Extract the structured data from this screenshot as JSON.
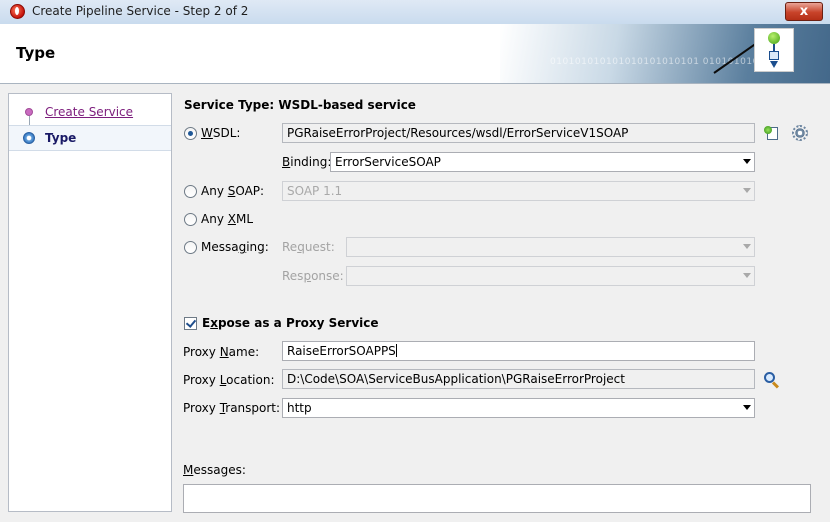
{
  "window": {
    "title": "Create Pipeline Service - Step 2 of 2",
    "close_label": "x"
  },
  "banner": {
    "title": "Type",
    "binary_text": "010101010101010101010101 0101010101010"
  },
  "nav": {
    "items": [
      {
        "label": "Create Service",
        "state": "visited"
      },
      {
        "label": "Type",
        "state": "current"
      }
    ]
  },
  "service_type": {
    "heading": "Service Type: WSDL-based service",
    "wsdl": {
      "label_prefix": "",
      "label_mnemonic": "W",
      "label_rest": "SDL:",
      "value": "PGRaiseErrorProject/Resources/wsdl/ErrorServiceV1SOAP",
      "selected": true
    },
    "binding": {
      "label_prefix": "",
      "label_mnemonic": "B",
      "label_rest": "inding:",
      "value": "ErrorServiceSOAP"
    },
    "any_soap": {
      "label_prefix": "Any ",
      "label_mnemonic": "S",
      "label_rest": "OAP:",
      "value": "SOAP 1.1"
    },
    "any_xml": {
      "label_prefix": "Any ",
      "label_mnemonic": "X",
      "label_rest": "ML"
    },
    "messaging": {
      "label_prefix": "Messa",
      "label_mnemonic": "g",
      "label_rest": "ing:",
      "request_prefix": "Re",
      "request_mnemonic": "q",
      "request_rest": "uest:",
      "request_value": "",
      "response_prefix": "Res",
      "response_mnemonic": "p",
      "response_rest": "onse:",
      "response_value": ""
    }
  },
  "proxy": {
    "expose_prefix": "E",
    "expose_mnemonic": "x",
    "expose_rest": "pose as a Proxy Service",
    "expose_checked": true,
    "name_prefix": "Proxy ",
    "name_mnemonic": "N",
    "name_rest": "ame:",
    "name_value": "RaiseErrorSOAPPS",
    "location_prefix": "Proxy ",
    "location_mnemonic": "L",
    "location_rest": "ocation:",
    "location_value": "D:\\Code\\SOA\\ServiceBusApplication\\PGRaiseErrorProject",
    "transport_prefix": "Proxy ",
    "transport_mnemonic": "T",
    "transport_rest": "ransport:",
    "transport_value": "http"
  },
  "messages": {
    "label_prefix": "",
    "label_mnemonic": "M",
    "label_rest": "essages:",
    "value": ""
  },
  "icons": {
    "wsdl_browse": "wsdl-browse-icon",
    "settings": "gear-icon",
    "location_search": "search-icon"
  }
}
